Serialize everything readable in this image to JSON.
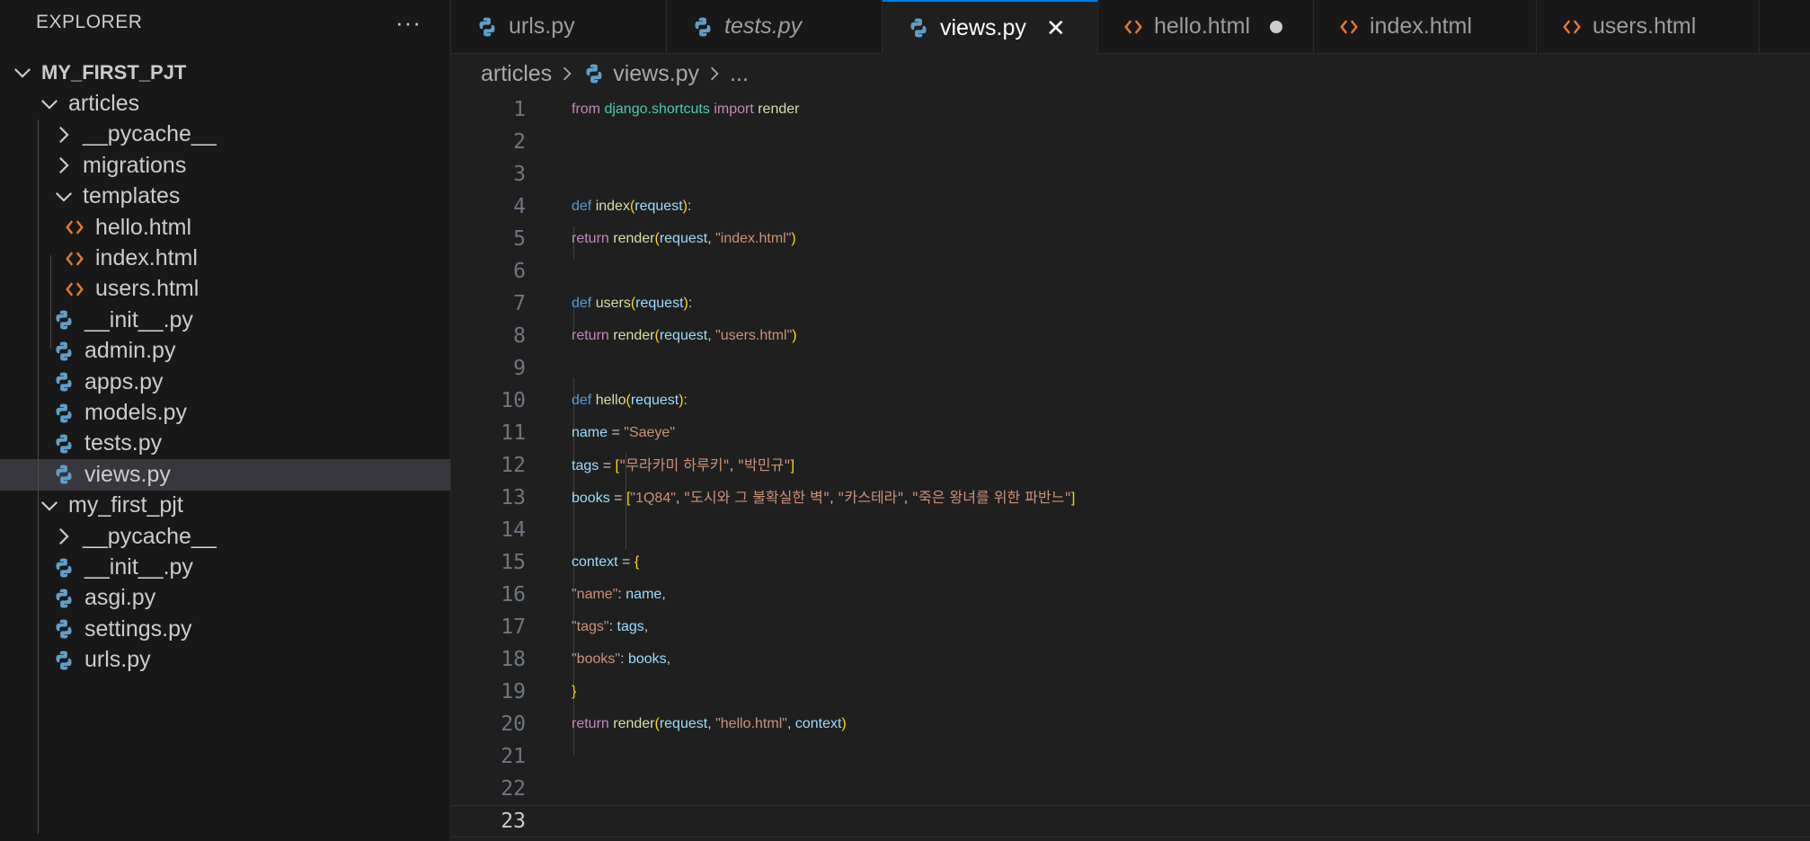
{
  "explorer": {
    "title": "EXPLORER",
    "more_label": "···",
    "project": "MY_FIRST_PJT",
    "items": [
      {
        "label": "articles",
        "kind": "folder-open"
      },
      {
        "label": "__pycache__",
        "kind": "folder-closed"
      },
      {
        "label": "migrations",
        "kind": "folder-closed"
      },
      {
        "label": "templates",
        "kind": "folder-open"
      },
      {
        "label": "hello.html",
        "kind": "html"
      },
      {
        "label": "index.html",
        "kind": "html"
      },
      {
        "label": "users.html",
        "kind": "html"
      },
      {
        "label": "__init__.py",
        "kind": "python"
      },
      {
        "label": "admin.py",
        "kind": "python"
      },
      {
        "label": "apps.py",
        "kind": "python"
      },
      {
        "label": "models.py",
        "kind": "python"
      },
      {
        "label": "tests.py",
        "kind": "python"
      },
      {
        "label": "views.py",
        "kind": "python",
        "selected": true
      },
      {
        "label": "my_first_pjt",
        "kind": "folder-open"
      },
      {
        "label": "__pycache__",
        "kind": "folder-closed"
      },
      {
        "label": "__init__.py",
        "kind": "python"
      },
      {
        "label": "asgi.py",
        "kind": "python"
      },
      {
        "label": "settings.py",
        "kind": "python"
      },
      {
        "label": "urls.py",
        "kind": "python"
      }
    ]
  },
  "tabs": [
    {
      "label": "urls.py",
      "icon": "python-icon"
    },
    {
      "label": "tests.py",
      "icon": "python-icon",
      "italic": true
    },
    {
      "label": "views.py",
      "icon": "python-icon",
      "active": true,
      "close": "✕"
    },
    {
      "label": "hello.html",
      "icon": "html-icon",
      "dirty": true
    },
    {
      "label": "index.html",
      "icon": "html-icon"
    },
    {
      "label": "users.html",
      "icon": "html-icon"
    }
  ],
  "breadcrumb": {
    "folder": "articles",
    "file": "views.py",
    "symbol": "..."
  },
  "editor": {
    "current_line": 23,
    "line_numbers": [
      "1",
      "2",
      "3",
      "4",
      "5",
      "6",
      "7",
      "8",
      "9",
      "10",
      "11",
      "12",
      "13",
      "14",
      "15",
      "16",
      "17",
      "18",
      "19",
      "20",
      "21",
      "22",
      "23"
    ],
    "code": {
      "l1": {
        "from": "from",
        "module": "django.shortcuts",
        "import": "import",
        "name": "render"
      },
      "l4": {
        "def": "def",
        "fn": "index",
        "param": "request"
      },
      "l5": {
        "ret": "return",
        "fn": "render",
        "arg": "request",
        "str": "\"index.html\""
      },
      "l7": {
        "def": "def",
        "fn": "users",
        "param": "request"
      },
      "l8": {
        "ret": "return",
        "fn": "render",
        "arg": "request",
        "str": "\"users.html\""
      },
      "l10": {
        "def": "def",
        "fn": "hello",
        "param": "request"
      },
      "l11": {
        "var": "name",
        "str": "\"Saeye\""
      },
      "l12": {
        "var": "tags",
        "s1": "\"무라카미 하루키\"",
        "s2": "\"박민규\""
      },
      "l13": {
        "var": "books",
        "s1": "\"1Q84\"",
        "s2": "\"도시와 그 불확실한 벽\"",
        "s3": "\"카스테라\"",
        "s4": "\"죽은 왕녀를 위한 파반느\""
      },
      "l15": {
        "var": "context"
      },
      "l16": {
        "key": "\"name\"",
        "val": "name"
      },
      "l17": {
        "key": "\"tags\"",
        "val": "tags"
      },
      "l18": {
        "key": "\"books\"",
        "val": "books"
      },
      "l20": {
        "ret": "return",
        "fn": "render",
        "arg": "request",
        "str": "\"hello.html\"",
        "ctx": "context"
      }
    }
  }
}
